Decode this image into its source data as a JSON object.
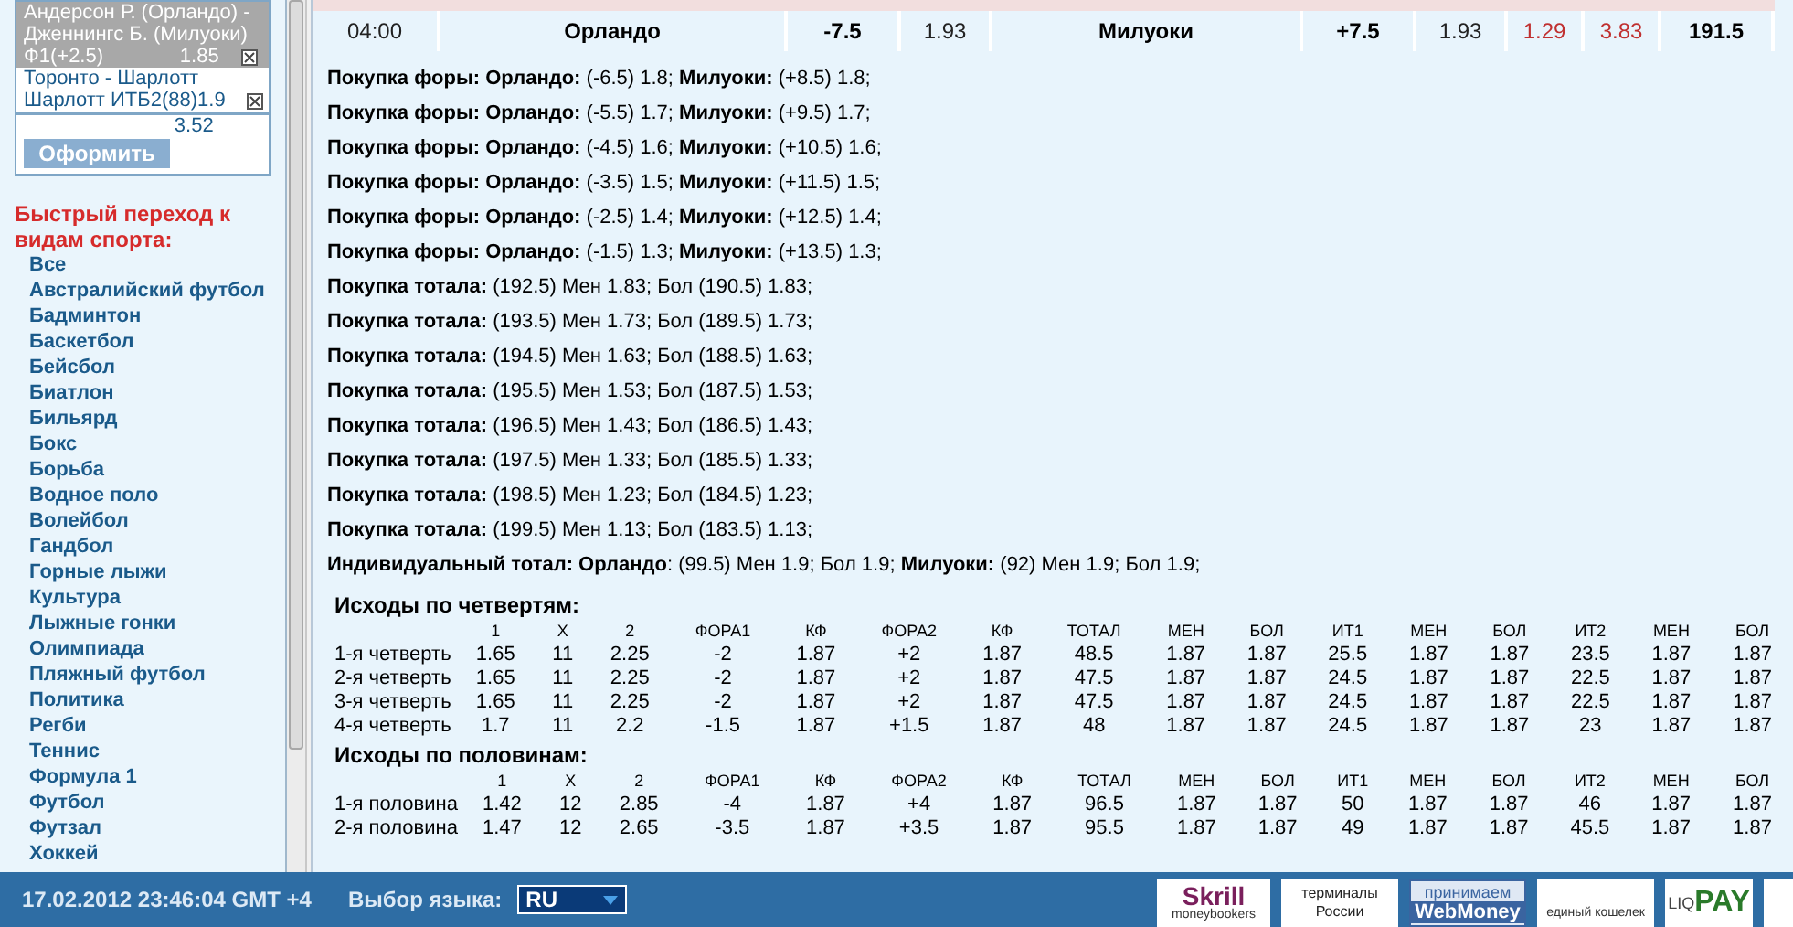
{
  "coupon": {
    "bets": [
      {
        "lines": [
          "Андерсон Р. (Орландо) -",
          "Дженнингс Б. (Милуоки)"
        ],
        "bet": "Ф1(+2.5)",
        "odds": "1.85",
        "selected": true
      },
      {
        "lines": [
          "Торонто - Шарлотт"
        ],
        "bet": "Шарлотт ИТБ2(88)",
        "odds": "1.9",
        "selected": false
      }
    ],
    "total": "3.52",
    "submit": "Оформить"
  },
  "sports": {
    "title": "Быстрый переход к видам спорта:",
    "items": [
      "Все",
      "Австралийский футбол",
      "Бадминтон",
      "Баскетбол",
      "Бейсбол",
      "Биатлон",
      "Бильярд",
      "Бокс",
      "Борьба",
      "Водное поло",
      "Волейбол",
      "Гандбол",
      "Горные лыжи",
      "Культура",
      "Лыжные гонки",
      "Олимпиада",
      "Пляжный футбол",
      "Политика",
      "Регби",
      "Теннис",
      "Формула 1",
      "Футбол",
      "Футзал",
      "Хоккей"
    ]
  },
  "match": {
    "cells": [
      {
        "text": "04:00",
        "kind": "plain"
      },
      {
        "text": "Орландо",
        "kind": "bold"
      },
      {
        "text": "-7.5",
        "kind": "bold"
      },
      {
        "text": "1.93",
        "kind": "plain"
      },
      {
        "text": "Милуоки",
        "kind": "bold"
      },
      {
        "text": "+7.5",
        "kind": "bold"
      },
      {
        "text": "1.93",
        "kind": "plain"
      },
      {
        "text": "1.29",
        "kind": "red"
      },
      {
        "text": "3.83",
        "kind": "red"
      },
      {
        "text": "191.5",
        "kind": "bold"
      }
    ]
  },
  "offers": [
    "**Покупка форы: Орландо:** (-6.5) 1.8; **Милуоки:** (+8.5) 1.8;",
    "**Покупка форы: Орландо:** (-5.5) 1.7; **Милуоки:** (+9.5) 1.7;",
    "**Покупка форы: Орландо:** (-4.5) 1.6; **Милуоки:** (+10.5) 1.6;",
    "**Покупка форы: Орландо:** (-3.5) 1.5; **Милуоки:** (+11.5) 1.5;",
    "**Покупка форы: Орландо:** (-2.5) 1.4; **Милуоки:** (+12.5) 1.4;",
    "**Покупка форы: Орландо:** (-1.5) 1.3; **Милуоки:** (+13.5) 1.3;",
    "**Покупка тотала:** (192.5) Мен 1.83; Бол (190.5) 1.83;",
    "**Покупка тотала:** (193.5) Мен 1.73; Бол (189.5) 1.73;",
    "**Покупка тотала:** (194.5) Мен 1.63; Бол (188.5) 1.63;",
    "**Покупка тотала:** (195.5) Мен 1.53; Бол (187.5) 1.53;",
    "**Покупка тотала:** (196.5) Мен 1.43; Бол (186.5) 1.43;",
    "**Покупка тотала:** (197.5) Мен 1.33; Бол (185.5) 1.33;",
    "**Покупка тотала:** (198.5) Мен 1.23; Бол (184.5) 1.23;",
    "**Покупка тотала:** (199.5) Мен 1.13; Бол (183.5) 1.13;",
    "**Индивидуальный тотал: Орландо**: (99.5) Мен 1.9; Бол 1.9; **Милуоки:** (92) Мен 1.9; Бол 1.9;"
  ],
  "periods": [
    {
      "title": "Исходы по четвертям:",
      "columns": [
        "",
        "1",
        "X",
        "2",
        "ФОРА1",
        "КФ",
        "ФОРА2",
        "КФ",
        "ТОТАЛ",
        "МЕН",
        "БОЛ",
        "ИТ1",
        "МЕН",
        "БОЛ",
        "ИТ2",
        "МЕН",
        "БОЛ"
      ],
      "rows": [
        [
          "1-я четверть",
          "1.65",
          "11",
          "2.25",
          "-2",
          "1.87",
          "+2",
          "1.87",
          "48.5",
          "1.87",
          "1.87",
          "25.5",
          "1.87",
          "1.87",
          "23.5",
          "1.87",
          "1.87"
        ],
        [
          "2-я четверть",
          "1.65",
          "11",
          "2.25",
          "-2",
          "1.87",
          "+2",
          "1.87",
          "47.5",
          "1.87",
          "1.87",
          "24.5",
          "1.87",
          "1.87",
          "22.5",
          "1.87",
          "1.87"
        ],
        [
          "3-я четверть",
          "1.65",
          "11",
          "2.25",
          "-2",
          "1.87",
          "+2",
          "1.87",
          "47.5",
          "1.87",
          "1.87",
          "24.5",
          "1.87",
          "1.87",
          "22.5",
          "1.87",
          "1.87"
        ],
        [
          "4-я четверть",
          "1.7",
          "11",
          "2.2",
          "-1.5",
          "1.87",
          "+1.5",
          "1.87",
          "48",
          "1.87",
          "1.87",
          "24.5",
          "1.87",
          "1.87",
          "23",
          "1.87",
          "1.87"
        ]
      ]
    },
    {
      "title": "Исходы по половинам:",
      "columns": [
        "",
        "1",
        "X",
        "2",
        "ФОРА1",
        "КФ",
        "ФОРА2",
        "КФ",
        "ТОТАЛ",
        "МЕН",
        "БОЛ",
        "ИТ1",
        "МЕН",
        "БОЛ",
        "ИТ2",
        "МЕН",
        "БОЛ"
      ],
      "rows": [
        [
          "1-я половина",
          "1.42",
          "12",
          "2.85",
          "-4",
          "1.87",
          "+4",
          "1.87",
          "96.5",
          "1.87",
          "1.87",
          "50",
          "1.87",
          "1.87",
          "46",
          "1.87",
          "1.87"
        ],
        [
          "2-я половина",
          "1.47",
          "12",
          "2.65",
          "-3.5",
          "1.87",
          "+3.5",
          "1.87",
          "95.5",
          "1.87",
          "1.87",
          "49",
          "1.87",
          "1.87",
          "45.5",
          "1.87",
          "1.87"
        ]
      ]
    }
  ],
  "footer": {
    "datetime": "17.02.2012 23:46:04 GMT +4",
    "language_label": "Выбор языка:",
    "language": "RU",
    "payments": [
      {
        "kind": "skrill",
        "lines": [
          "Skrill",
          "moneybookers"
        ]
      },
      {
        "kind": "terminal",
        "lines": [
          "терминалы",
          "России"
        ]
      },
      {
        "kind": "webmoney",
        "lines": [
          "принимаем",
          "WebMoney"
        ]
      },
      {
        "kind": "wallet",
        "lines": [
          "единый кошелек"
        ]
      },
      {
        "kind": "liqpay",
        "lines": [
          "LIQ",
          "PAY"
        ]
      }
    ]
  }
}
